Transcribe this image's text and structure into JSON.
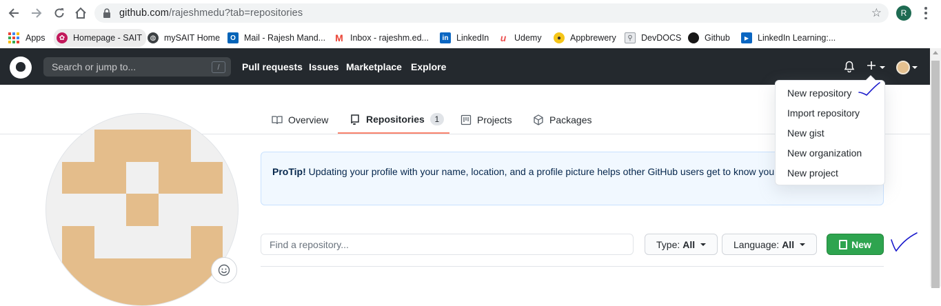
{
  "browser": {
    "url_host": "github.com",
    "url_path": "/rajeshmedu?tab=repositories",
    "profile_initial": "R",
    "bookmarks": [
      {
        "label": "Apps",
        "icon": "apps-grid-icon"
      },
      {
        "label": "Homepage - SAIT",
        "icon": "sait-icon"
      },
      {
        "label": "mySAIT Home",
        "icon": "globe-icon"
      },
      {
        "label": "Mail - Rajesh Mand...",
        "icon": "outlook-icon"
      },
      {
        "label": "Inbox - rajeshm.ed...",
        "icon": "gmail-icon"
      },
      {
        "label": "LinkedIn",
        "icon": "linkedin-icon"
      },
      {
        "label": "Udemy",
        "icon": "udemy-icon"
      },
      {
        "label": "Appbrewery",
        "icon": "appbrewery-icon"
      },
      {
        "label": "DevDOCS",
        "icon": "devdocs-icon"
      },
      {
        "label": "Github",
        "icon": "github-icon"
      },
      {
        "label": "LinkedIn Learning:...",
        "icon": "linkedin-learning-icon"
      }
    ]
  },
  "header": {
    "search_placeholder": "Search or jump to...",
    "search_shortcut": "/",
    "nav": [
      "Pull requests",
      "Issues",
      "Marketplace",
      "Explore"
    ]
  },
  "tabs": [
    {
      "label": "Overview",
      "icon": "book-icon"
    },
    {
      "label": "Repositories",
      "icon": "repo-icon",
      "count": "1",
      "active": true
    },
    {
      "label": "Projects",
      "icon": "project-icon"
    },
    {
      "label": "Packages",
      "icon": "package-icon"
    }
  ],
  "protip": {
    "strong": "ProTip!",
    "text": " Updating your profile with your name, location, and a profile picture helps other GitHub users get to know you."
  },
  "filters": {
    "find_placeholder": "Find a repository...",
    "type_label": "Type:",
    "type_value": "All",
    "language_label": "Language:",
    "language_value": "All",
    "new_label": "New"
  },
  "dropdown": {
    "items": [
      "New repository",
      "Import repository",
      "New gist",
      "New organization",
      "New project"
    ]
  },
  "colors": {
    "header_bg": "#24292e",
    "new_button": "#2ea44f",
    "active_tab_underline": "#f9826c",
    "identicon": "#e4bd8b",
    "annotation_ink": "#1a1acc"
  }
}
